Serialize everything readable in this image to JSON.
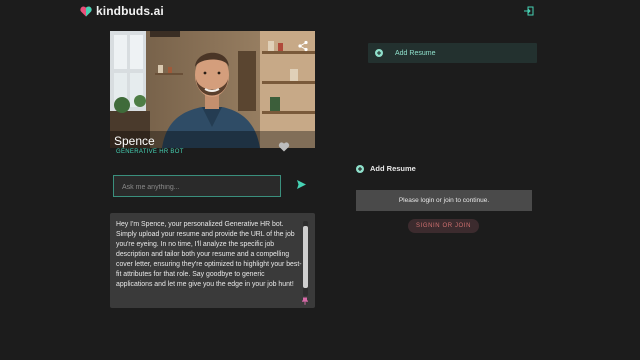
{
  "app": {
    "name": "kindbuds.ai"
  },
  "bot": {
    "name": "Spence",
    "role": "GENERATIVE HR BOT",
    "intro": "Hey I'm Spence, your personalized Generative HR bot. Simply upload your resume and provide the URL of the job you're eyeing. In no time, I'll analyze the specific job description and tailor both your resume and a compelling cover letter, ensuring they're optimized to highlight your best-fit attributes for that role. Say goodbye to generic applications and let me give you the edge in your job hunt!"
  },
  "chat": {
    "placeholder": "Ask me anything..."
  },
  "right_panel": {
    "add_resume_button": "Add Resume",
    "add_resume_heading": "Add Resume",
    "login_message": "Please login or join to continue.",
    "signin_button": "SIGNIN OR JOIN"
  },
  "colors": {
    "accent": "#46d2b4",
    "background": "#1c1c1c",
    "signin_text": "#d07070"
  },
  "icons": [
    "heart-logo-icon",
    "exit-icon",
    "share-icon",
    "heart-icon",
    "send-icon",
    "plus-circle-icon",
    "pin-icon"
  ]
}
